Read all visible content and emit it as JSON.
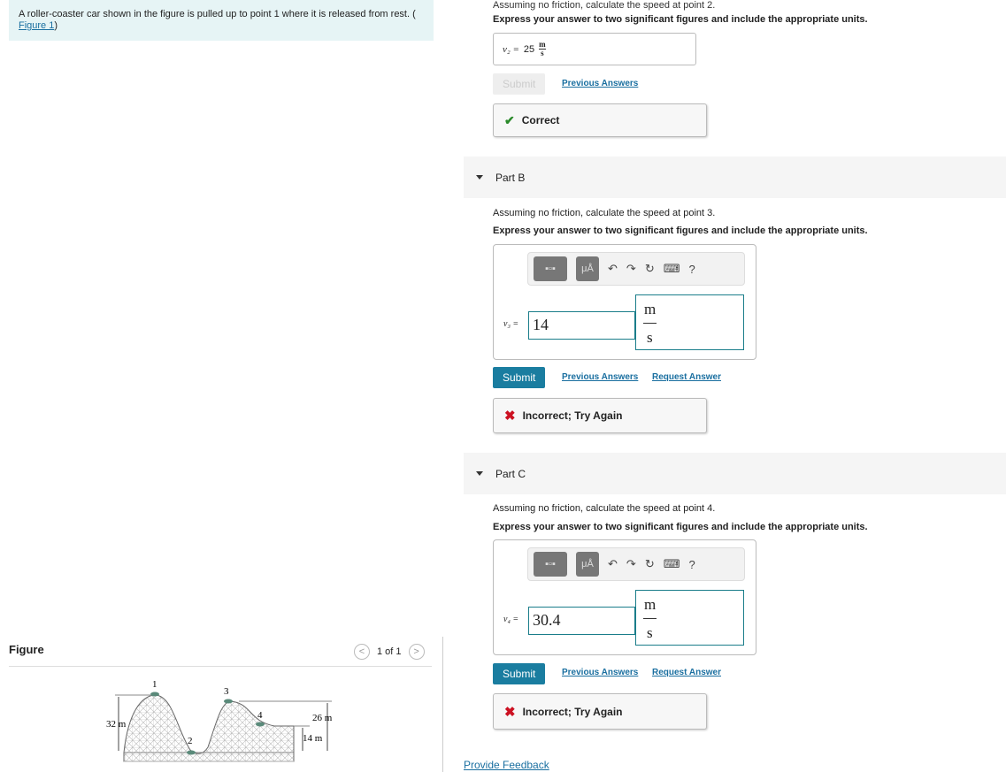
{
  "intro": {
    "text": "A roller-coaster car shown in the figure is pulled up to point 1 where it is released from rest. (",
    "link": "Figure 1",
    "close": ")"
  },
  "figure": {
    "title": "Figure",
    "pager": "1 of 1",
    "labels": {
      "p1": "1",
      "p2": "2",
      "p3": "3",
      "p4": "4",
      "h1": "32 m",
      "h3": "26 m",
      "h4": "14 m"
    }
  },
  "partA": {
    "question": "Assuming no friction, calculate the speed at point 2.",
    "instruction": "Express your answer to two significant figures and include the appropriate units.",
    "var": "v₂ =",
    "value": "25",
    "unit_num": "m",
    "unit_den": "s",
    "submit": "Submit",
    "previous": "Previous Answers",
    "feedback": "Correct"
  },
  "partB": {
    "title": "Part B",
    "question": "Assuming no friction, calculate the speed at point 3.",
    "instruction": "Express your answer to two significant figures and include the appropriate units.",
    "var": "v₃ =",
    "value": "14",
    "unit_num": "m",
    "unit_den": "s",
    "submit": "Submit",
    "previous": "Previous Answers",
    "request": "Request Answer",
    "feedback": "Incorrect; Try Again"
  },
  "partC": {
    "title": "Part C",
    "question": "Assuming no friction, calculate the speed at point 4.",
    "instruction": "Express your answer to two significant figures and include the appropriate units.",
    "var": "v₄ =",
    "value": "30.4",
    "unit_num": "m",
    "unit_den": "s",
    "submit": "Submit",
    "previous": "Previous Answers",
    "request": "Request Answer",
    "feedback": "Incorrect; Try Again"
  },
  "toolbar": {
    "units_btn": "μÅ",
    "help": "?"
  },
  "footer": {
    "feedback_link": "Provide Feedback"
  },
  "colors": {
    "accent": "#1a7da0",
    "correct": "#2a8a2a",
    "incorrect": "#cc1122"
  }
}
